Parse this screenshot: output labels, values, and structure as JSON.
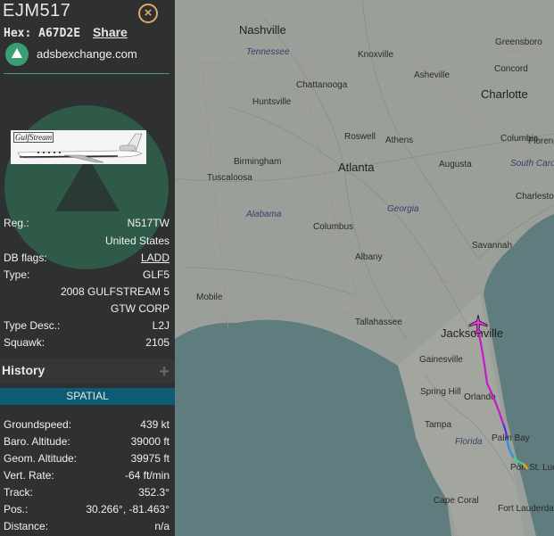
{
  "flight": {
    "callsign": "EJM517",
    "hex_label": "Hex:",
    "hex": "A67D2E",
    "share": "Share",
    "site": "adsbexchange.com",
    "photo_brand": "GulfStream"
  },
  "aircraft": [
    {
      "key": "Reg.:",
      "value": "N517TW"
    },
    {
      "key": "",
      "value": "United States"
    },
    {
      "key": "DB flags:",
      "value": "LADD"
    },
    {
      "key": "Type:",
      "value": "GLF5"
    },
    {
      "key": "",
      "value": "2008 GULFSTREAM 5"
    },
    {
      "key": "",
      "value": "GTW CORP"
    },
    {
      "key": "Type Desc.:",
      "value": "L2J"
    },
    {
      "key": "Squawk:",
      "value": "2105"
    }
  ],
  "history": {
    "label": "History",
    "plus": "+"
  },
  "spatial": {
    "header": "SPATIAL",
    "rows": [
      {
        "key": "Groundspeed:",
        "value": "439 kt"
      },
      {
        "key": "Baro. Altitude:",
        "value": "39000 ft"
      },
      {
        "key": "Geom. Altitude:",
        "value": "39975 ft"
      },
      {
        "key": "Vert. Rate:",
        "value": "-64 ft/min"
      },
      {
        "key": "Track:",
        "value": "352.3°"
      },
      {
        "key": "Pos.:",
        "value": "30.266°, -81.463°"
      },
      {
        "key": "Distance:",
        "value": "n/a"
      }
    ]
  },
  "map": {
    "cities": [
      "Nashville",
      "Knoxville",
      "Greensboro",
      "Asheville",
      "Concord",
      "Charlotte",
      "Chattanooga",
      "Huntsville",
      "Roswell",
      "Athens",
      "Columbia",
      "Florence",
      "Atlanta",
      "Birmingham",
      "Augusta",
      "Tuscaloosa",
      "Charleston",
      "Columbus",
      "Savannah",
      "Albany",
      "Mobile",
      "Tallahassee",
      "Jacksonville",
      "Gainesville",
      "Orlando",
      "Spring Hill",
      "Tampa",
      "Palm Bay",
      "Port St. Lucie",
      "Cape Coral",
      "Fort Lauderdale"
    ],
    "states": [
      "Tennessee",
      "South Carolina",
      "Alabama",
      "Georgia",
      "Florida"
    ],
    "aircraft_icon": "plane-icon",
    "colors": {
      "track_main": "#c41acc",
      "track_low": "#f2a01e",
      "aircraft": "#e23ce0",
      "water": "#5f7c7e",
      "land": "#9a9f99",
      "accent": "#3a9e74"
    }
  }
}
